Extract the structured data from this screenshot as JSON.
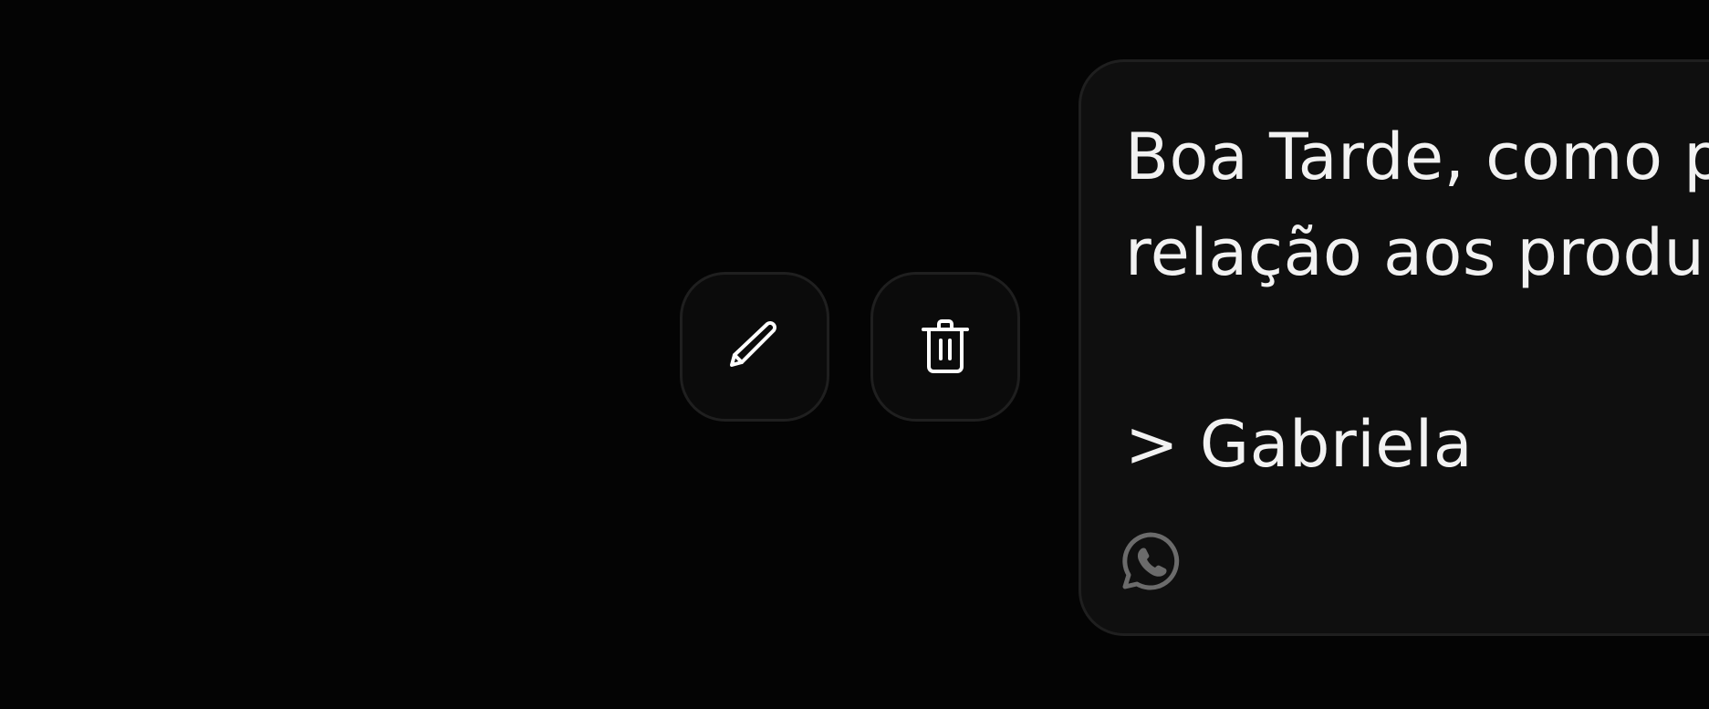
{
  "actions": {
    "edit": {
      "icon": "pencil-icon",
      "label": "Edit"
    },
    "delete": {
      "icon": "trash-icon",
      "label": "Delete"
    }
  },
  "message": {
    "lines": [
      "Boa Tarde, como p",
      "relação aos produ",
      "",
      "> Gabriela"
    ],
    "channel_icon": "whatsapp-icon"
  },
  "colors": {
    "background": "#040404",
    "card": "#0f0f0f",
    "border": "#1f1f1f",
    "text": "#f2f2f2",
    "muted_icon": "#6b6b6b"
  }
}
